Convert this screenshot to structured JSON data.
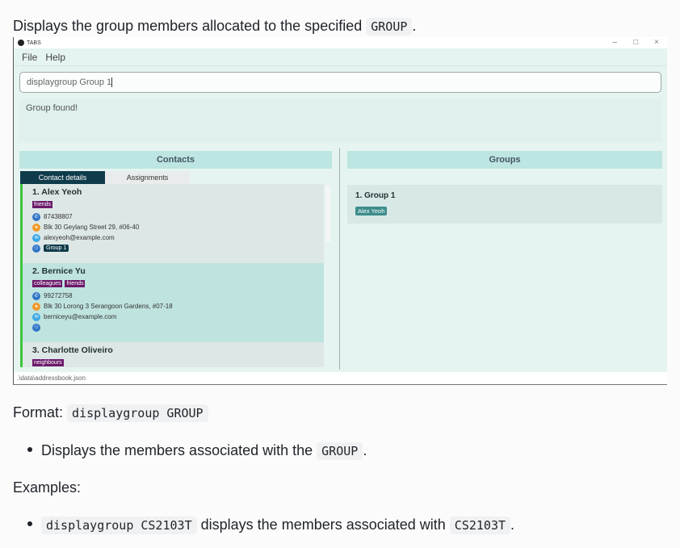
{
  "doc": {
    "intro_text": "Displays the group members allocated to the specified",
    "intro_code": "GROUP",
    "intro_end": ".",
    "format_label": "Format:",
    "format_code": "displaygroup GROUP",
    "bullet1_text": "Displays the members associated with the",
    "bullet1_code": "GROUP",
    "bullet1_end": ".",
    "examples_label": "Examples:",
    "example_code": "displaygroup CS2103T",
    "example_text": "displays the members associated with",
    "example_code2": "CS2103T",
    "example_end": "."
  },
  "app": {
    "title": "TABS",
    "controls": {
      "minimize": "–",
      "maximize": "□",
      "close": "×"
    },
    "menu": {
      "file": "File",
      "help": "Help"
    },
    "command_value": "displaygroup Group 1",
    "result_text": "Group found!",
    "contacts_header": "Contacts",
    "groups_header": "Groups",
    "tabs": {
      "contact_details": "Contact details",
      "assignments": "Assignments"
    },
    "contacts": [
      {
        "index_name": "1.  Alex Yeoh",
        "tags": [
          "friends"
        ],
        "phone": "87438807",
        "address": "Blk 30 Geylang Street 29, #06-40",
        "email": "alexyeoh@example.com",
        "group": "Group 1"
      },
      {
        "index_name": "2.  Bernice Yu",
        "tags": [
          "colleagues",
          "friends"
        ],
        "phone": "99272758",
        "address": "Blk 30 Lorong 3 Serangoon Gardens, #07-18",
        "email": "berniceyu@example.com",
        "group": ""
      },
      {
        "index_name": "3.  Charlotte Oliveiro",
        "tags": [
          "neighbours"
        ]
      }
    ],
    "groups": [
      {
        "index_name": "1.  Group 1",
        "members": [
          "Alex Yeoh"
        ]
      }
    ],
    "status_path": ".\\data\\addressbook.json"
  },
  "icons": {
    "phone": "phone-icon",
    "address": "location-icon",
    "email": "email-icon",
    "group": "group-icon"
  },
  "colors": {
    "accent_dark": "#0f3b4a",
    "tag_purple": "#6c1a6b",
    "card_border": "#3cc43c",
    "header_teal": "#bde5e1"
  }
}
